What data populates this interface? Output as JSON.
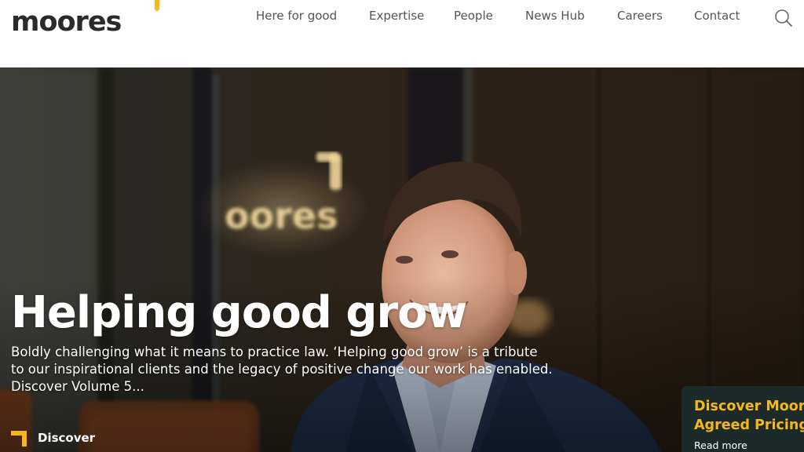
{
  "header": {
    "logo_text": "moores",
    "nav": [
      {
        "label": "Here for good"
      },
      {
        "label": "Expertise"
      },
      {
        "label": "People"
      },
      {
        "label": "News Hub"
      },
      {
        "label": "Careers"
      },
      {
        "label": "Contact"
      }
    ],
    "search_icon": "search-icon"
  },
  "hero": {
    "sign_text": "oores",
    "title": "Helping good grow",
    "description_lines": [
      "Boldly challenging what it means to practice law. ‘Helping good grow’ is a tribute",
      "to our inspirational clients and the legacy of positive change our work has enabled.",
      "Discover Volume 5..."
    ],
    "discover_label": "Discover"
  },
  "promo": {
    "title_lines": [
      "Discover Moores",
      "Agreed Pricing"
    ],
    "link_label": "Read more"
  },
  "colors": {
    "brand_yellow": "#f5b81c",
    "logo_text": "#2a2a2a",
    "nav_text": "#555555",
    "promo_bg": "#1c2a2a"
  }
}
